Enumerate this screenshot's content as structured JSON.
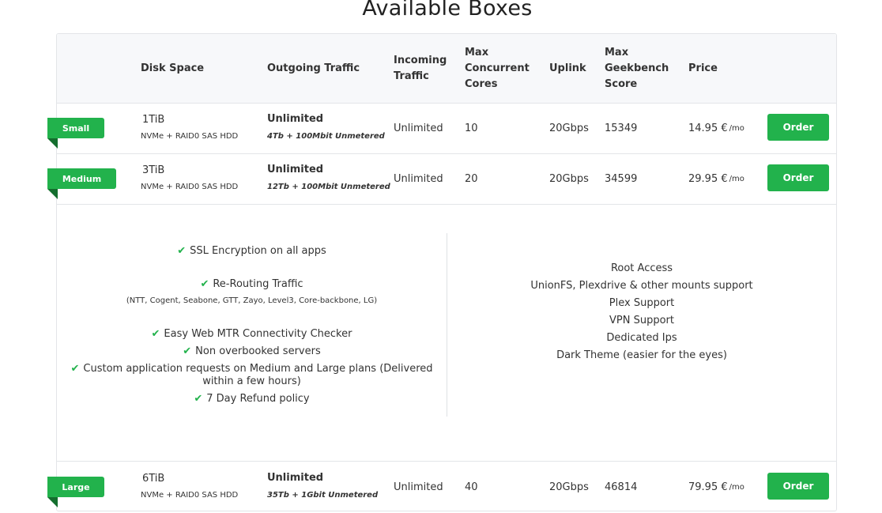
{
  "page_title": "Available Boxes",
  "headers": {
    "disk": "Disk Space",
    "outgoing_1": "Outgoing Traffic",
    "incoming_1": "Incoming",
    "incoming_2": "Traffic",
    "cores_1": "Max",
    "cores_2": "Concurrent",
    "cores_3": "Cores",
    "uplink": "Uplink",
    "geek_1": "Max",
    "geek_2": "Geekbench",
    "geek_3": "Score",
    "price": "Price"
  },
  "plans": [
    {
      "name": "Small",
      "disk": "1TiB",
      "disk_sub": "NVMe + RAID0 SAS HDD",
      "outgoing": "Unlimited",
      "outgoing_sub": "4Tb + 100Mbit Unmetered",
      "incoming": "Unlimited",
      "cores": "10",
      "uplink": "20Gbps",
      "geekbench": "15349",
      "price": "14.95 €",
      "per": "/mo",
      "order": "Order"
    },
    {
      "name": "Medium",
      "disk": "3TiB",
      "disk_sub": "NVMe + RAID0 SAS HDD",
      "outgoing": "Unlimited",
      "outgoing_sub": "12Tb + 100Mbit Unmetered",
      "incoming": "Unlimited",
      "cores": "20",
      "uplink": "20Gbps",
      "geekbench": "34599",
      "price": "29.95 €",
      "per": "/mo",
      "order": "Order"
    },
    {
      "name": "Large",
      "disk": "6TiB",
      "disk_sub": "NVMe + RAID0 SAS HDD",
      "outgoing": "Unlimited",
      "outgoing_sub": "35Tb + 1Gbit Unmetered",
      "incoming": "Unlimited",
      "cores": "40",
      "uplink": "20Gbps",
      "geekbench": "46814",
      "price": "79.95 €",
      "per": "/mo",
      "order": "Order"
    }
  ],
  "features_left": {
    "ssl": "SSL Encryption on all apps",
    "rerouting": "Re-Routing Traffic",
    "rerouting_sub": "(NTT, Cogent, Seabone, GTT, Zayo, Level3, Core-backbone, LG)",
    "mtr": "Easy Web MTR Connectivity Checker",
    "overbooked": "Non overbooked servers",
    "custom_1": "Custom application requests on Medium and Large plans (Delivered",
    "custom_2": "within a few hours)",
    "refund": "7 Day Refund policy"
  },
  "features_right": [
    "Root Access",
    "UnionFS, Plexdrive & other mounts support",
    "Plex Support",
    "VPN Support",
    "Dedicated Ips",
    "Dark Theme (easier for the eyes)"
  ],
  "icons": {
    "check": "check-icon"
  },
  "colors": {
    "accent": "#22b24c",
    "ribbon_fold": "#146e2e",
    "header_bg": "#f7f8fa"
  }
}
